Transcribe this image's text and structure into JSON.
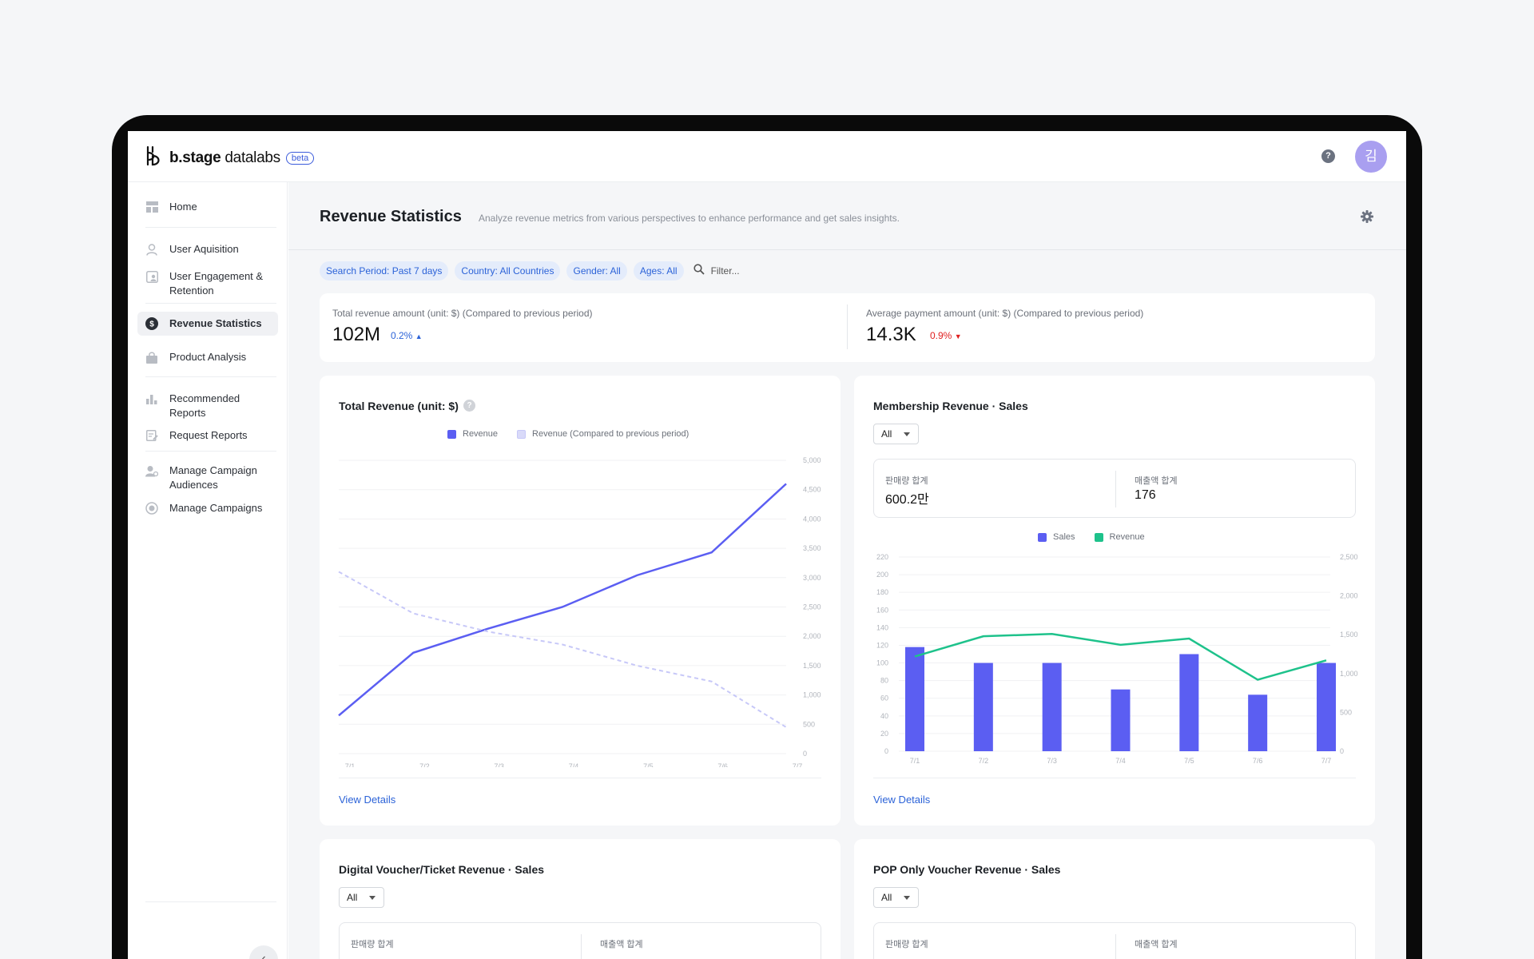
{
  "app": {
    "brand": "b.stage",
    "product": "datalabs",
    "badge": "beta",
    "help": "?",
    "avatar": "김"
  },
  "sidebar": {
    "items": [
      {
        "label": "Home",
        "icon": "dashboard-icon"
      },
      {
        "label": "User Aquisition",
        "icon": "user-icon"
      },
      {
        "label": "User Engagement & Retention",
        "icon": "user-retention-icon"
      },
      {
        "label": "Revenue Statistics",
        "icon": "dollar-icon",
        "active": true
      },
      {
        "label": "Product Analysis",
        "icon": "bag-icon"
      },
      {
        "label": "Recommended Reports",
        "icon": "bar-chart-icon"
      },
      {
        "label": "Request Reports",
        "icon": "edit-document-icon"
      },
      {
        "label": "Manage Campaign Audiences",
        "icon": "audience-icon"
      },
      {
        "label": "Manage Campaigns",
        "icon": "target-icon"
      }
    ],
    "collapse": "‹"
  },
  "header": {
    "title": "Revenue Statistics",
    "description": "Analyze revenue metrics from various perspectives to enhance performance and get sales insights."
  },
  "filters": {
    "chips": [
      "Search Period: Past 7 days",
      "Country: All Countries",
      "Gender: All",
      "Ages: All"
    ],
    "placeholder": "Filter..."
  },
  "kpis": {
    "total": {
      "label": "Total revenue amount (unit: $) (Compared to previous period)",
      "value": "102M",
      "delta": "0.2%",
      "direction": "up"
    },
    "average": {
      "label": "Average payment amount (unit: $) (Compared to previous period)",
      "value": "14.3K",
      "delta": "0.9%",
      "direction": "down"
    }
  },
  "colors": {
    "primary": "#5b5ef2",
    "compare": "#c7c8f8",
    "revenue_green": "#1ec28b",
    "link": "#2c63d8",
    "down": "#e02020"
  },
  "total_revenue_card": {
    "title": "Total Revenue (unit: $)",
    "legend": [
      "Revenue",
      "Revenue (Compared to previous period)"
    ],
    "view_details": "View Details"
  },
  "membership_card": {
    "title": "Membership Revenue · Sales",
    "select": "All",
    "stats": [
      {
        "label": "판매량 합계",
        "value": "600.2만"
      },
      {
        "label": "매출액 합계",
        "value": "176"
      }
    ],
    "legend": [
      "Sales",
      "Revenue"
    ],
    "view_details": "View Details"
  },
  "digital_card": {
    "title": "Digital Voucher/Ticket Revenue · Sales",
    "select": "All",
    "stats": [
      {
        "label": "판매량 합계"
      },
      {
        "label": "매출액 합계"
      }
    ]
  },
  "pop_card": {
    "title": "POP Only Voucher Revenue · Sales",
    "select": "All",
    "stats": [
      {
        "label": "판매량 합계"
      },
      {
        "label": "매출액 합계"
      }
    ]
  },
  "chart_data": [
    {
      "type": "line",
      "title": "Total Revenue (unit: $)",
      "x": [
        "7/1",
        "7/2",
        "7/3",
        "7/4",
        "7/5",
        "7/6",
        "7/7"
      ],
      "y_ticks": [
        "0",
        "500",
        "1,000",
        "1,500",
        "2,000",
        "2,500",
        "3,000",
        "3,500",
        "4,000",
        "4,500",
        "5,000"
      ],
      "ylim": [
        0,
        5000
      ],
      "y_axis_side": "right",
      "series": [
        {
          "name": "Revenue",
          "values": [
            650,
            1720,
            2130,
            2500,
            3040,
            3430,
            4600
          ],
          "style": "solid"
        },
        {
          "name": "Revenue (Compared to previous period)",
          "values": [
            3100,
            2390,
            2080,
            1860,
            1500,
            1230,
            450
          ],
          "style": "dashed"
        }
      ],
      "grid": true,
      "legend": "top-center"
    },
    {
      "type": "bar",
      "title": "Membership Revenue · Sales",
      "categories": [
        "7/1",
        "7/2",
        "7/3",
        "7/4",
        "7/5",
        "7/6",
        "7/7"
      ],
      "left_ticks": [
        "0",
        "20",
        "40",
        "60",
        "80",
        "100",
        "120",
        "140",
        "160",
        "180",
        "200",
        "220"
      ],
      "right_ticks": [
        "0",
        "500",
        "1,000",
        "1,500",
        "2,000",
        "2,500"
      ],
      "left_ylim": [
        0,
        220
      ],
      "right_ylim": [
        0,
        2500
      ],
      "series": [
        {
          "name": "Sales",
          "type": "bar",
          "axis": "left",
          "values": [
            118,
            100,
            100,
            70,
            110,
            64,
            100
          ]
        },
        {
          "name": "Revenue",
          "type": "line",
          "axis": "right",
          "values": [
            1220,
            1480,
            1510,
            1370,
            1450,
            920,
            1170
          ]
        }
      ],
      "grid": true,
      "legend": "top-center"
    }
  ]
}
